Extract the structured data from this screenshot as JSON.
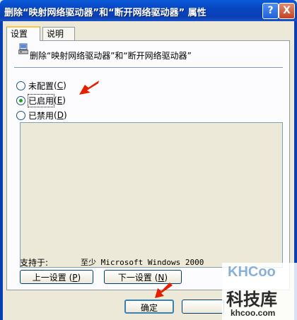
{
  "window": {
    "title": "删除“映射网络驱动器”和“断开网络驱动器” 属性",
    "help_label": "?",
    "close_label": "X"
  },
  "tabs": [
    {
      "label": "设置",
      "active": true
    },
    {
      "label": "说明",
      "active": false
    }
  ],
  "setting": {
    "icon": "policy-icon",
    "title": "删除“映射网络驱动器”和“断开网络驱动器”"
  },
  "options": [
    {
      "label": "未配置",
      "accel": "C",
      "checked": false
    },
    {
      "label": "已启用",
      "accel": "E",
      "checked": true
    },
    {
      "label": "已禁用",
      "accel": "D",
      "checked": false
    }
  ],
  "supported_on": {
    "label": "支持于:",
    "value": "至少 Microsoft Windows 2000"
  },
  "buttons": {
    "prev_setting": "上一设置",
    "prev_accel": "P",
    "next_setting": "下一设置",
    "next_accel": "N",
    "ok": "确定"
  },
  "watermark": {
    "brand": "KHCoo",
    "cn": "科技库",
    "url": "khcoo.com"
  },
  "colors": {
    "titlebar": "#0a46c2",
    "annotation_arrow": "#e61e00",
    "radio_dot": "#21a121"
  }
}
